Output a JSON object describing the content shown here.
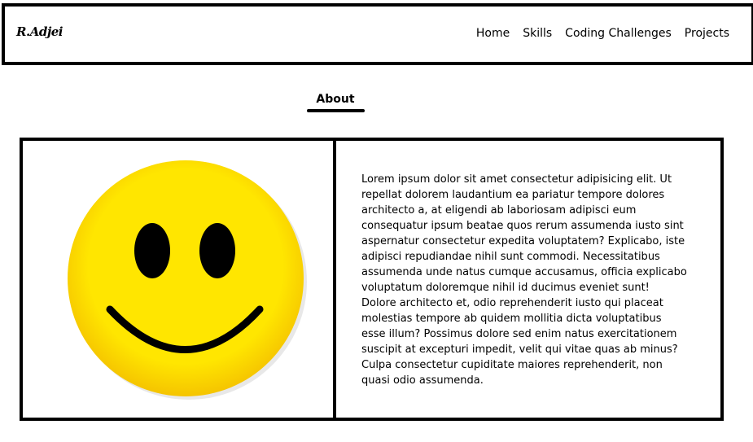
{
  "header": {
    "logo": "R.Adjei",
    "nav": [
      {
        "label": "Home"
      },
      {
        "label": "Skills"
      },
      {
        "label": "Coding Challenges"
      },
      {
        "label": "Projects"
      }
    ]
  },
  "about": {
    "heading": "About",
    "image_icon": "smiley-face-icon",
    "text": "Lorem ipsum dolor sit amet consectetur adipisicing elit. Ut repellat dolorem laudantium ea pariatur tempore dolores architecto a, at eligendi ab laboriosam adipisci eum consequatur ipsum beatae quos rerum assumenda iusto sint aspernatur consectetur expedita voluptatem? Explicabo, iste adipisci repudiandae nihil sunt commodi. Necessitatibus assumenda unde natus cumque accusamus, officia explicabo voluptatum doloremque nihil id ducimus eveniet sunt! Dolore architecto et, odio reprehenderit iusto qui placeat molestias tempore ab quidem mollitia dicta voluptatibus esse illum? Possimus dolore sed enim natus exercitationem suscipit at excepturi impedit, velit qui vitae quas ab minus? Culpa consectetur cupiditate maiores reprehenderit, non quasi odio assumenda."
  },
  "colors": {
    "smiley_yellow": "#FFE600",
    "border": "#000000"
  }
}
